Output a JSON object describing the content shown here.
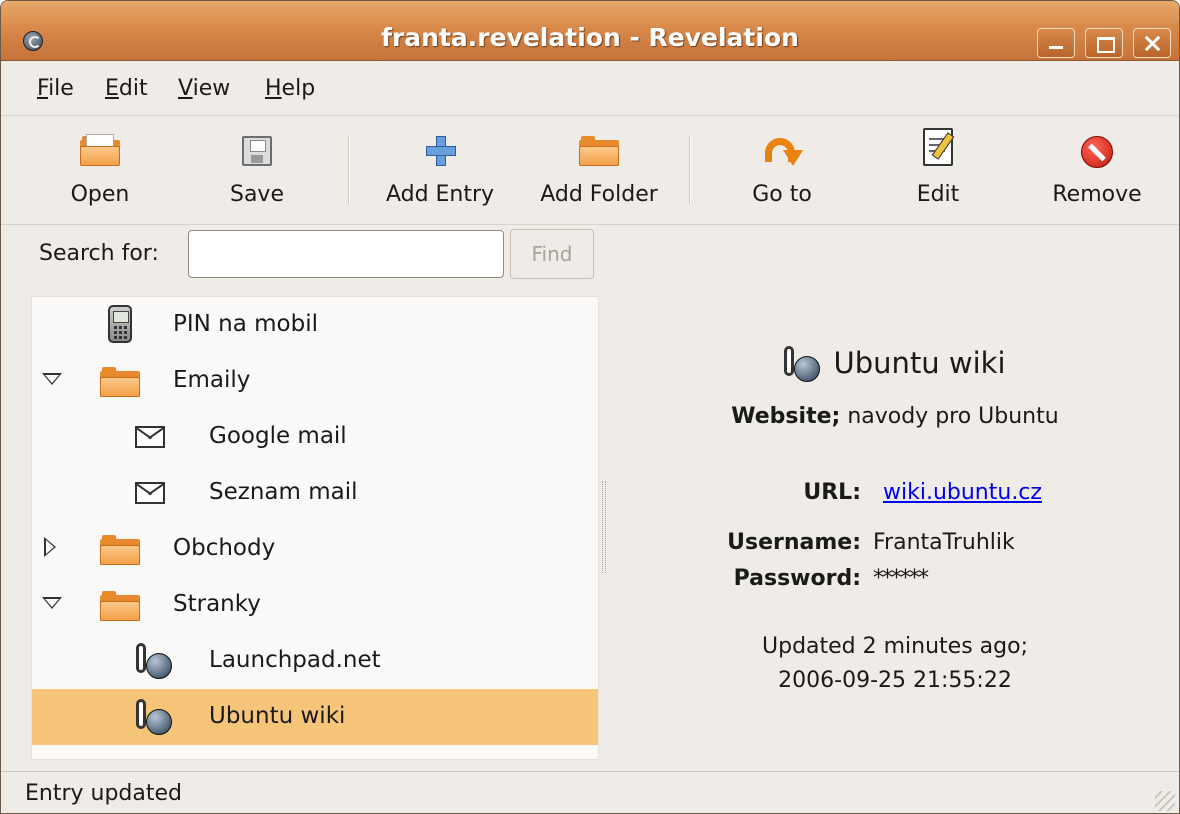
{
  "window": {
    "title": "franta.revelation - Revelation"
  },
  "menu": {
    "items": [
      "File",
      "Edit",
      "View",
      "Help"
    ]
  },
  "toolbar": {
    "open": "Open",
    "save": "Save",
    "add_entry": "Add Entry",
    "add_folder": "Add Folder",
    "goto": "Go to",
    "edit": "Edit",
    "remove": "Remove"
  },
  "search": {
    "label": "Search for:",
    "value": "",
    "find_label": "Find"
  },
  "tree": {
    "items": [
      {
        "label": "PIN na mobil",
        "icon": "phone-icon"
      },
      {
        "label": "Emaily",
        "icon": "folder-icon",
        "expanded": true
      },
      {
        "label": "Google mail",
        "icon": "mail-icon"
      },
      {
        "label": "Seznam mail",
        "icon": "mail-icon"
      },
      {
        "label": "Obchody",
        "icon": "folder-icon",
        "expanded": false
      },
      {
        "label": "Stranky",
        "icon": "folder-icon",
        "expanded": true
      },
      {
        "label": "Launchpad.net",
        "icon": "website-icon"
      },
      {
        "label": "Ubuntu wiki",
        "icon": "website-icon",
        "selected": true
      }
    ]
  },
  "details": {
    "title": "Ubuntu wiki",
    "type_label": "Website;",
    "description": "navody pro Ubuntu",
    "url_label": "URL:",
    "url_value": "wiki.ubuntu.cz",
    "username_label": "Username:",
    "username_value": "FrantaTruhlik",
    "password_label": "Password:",
    "password_value": "******",
    "updated_line1": "Updated 2 minutes ago;",
    "updated_line2": "2006-09-25 21:55:22"
  },
  "statusbar": {
    "text": "Entry updated"
  },
  "colors": {
    "titlebar": "#d9894a",
    "selection": "#f7c579",
    "link": "#0000ee",
    "window_bg": "#efebe7"
  }
}
